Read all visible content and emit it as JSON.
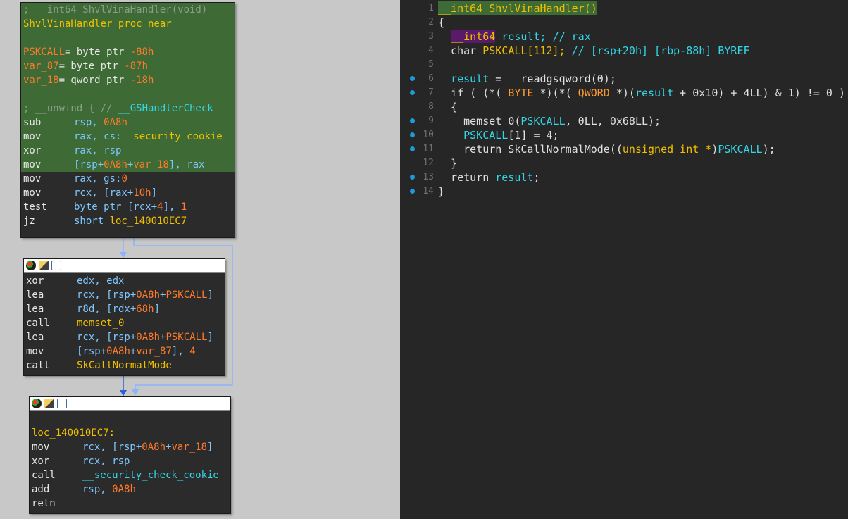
{
  "graph": {
    "block1": {
      "lines": [
        {
          "t": "; __int64 ShvlVinaHandler(void)",
          "c": "comment",
          "hl": true
        },
        {
          "t": "ShvlVinaHandler proc near",
          "c": "yellow",
          "hl": true
        },
        {
          "t": "",
          "c": "white",
          "hl": true
        },
        {
          "parts": [
            [
              "PSKCALL",
              "orange"
            ],
            [
              "= byte ptr ",
              "white"
            ],
            [
              "-88h",
              "num"
            ]
          ],
          "hl": true
        },
        {
          "parts": [
            [
              "var_87",
              "orange"
            ],
            [
              "= byte ptr ",
              "white"
            ],
            [
              "-87h",
              "num"
            ]
          ],
          "hl": true
        },
        {
          "parts": [
            [
              "var_18",
              "orange"
            ],
            [
              "= qword ptr ",
              "white"
            ],
            [
              "-18h",
              "num"
            ]
          ],
          "hl": true
        },
        {
          "t": "",
          "c": "white",
          "hl": true
        },
        {
          "parts": [
            [
              "; __unwind { // ",
              "comment"
            ],
            [
              "__GSHandlerCheck",
              "cyan"
            ]
          ],
          "hl": true
        },
        {
          "mn": "sub",
          "parts": [
            [
              "rsp, ",
              "reg"
            ],
            [
              "0A8h",
              "num"
            ]
          ],
          "hl": true
        },
        {
          "mn": "mov",
          "parts": [
            [
              "rax, cs:",
              "reg"
            ],
            [
              "__security_cookie",
              "yellow"
            ]
          ],
          "hl": true
        },
        {
          "mn": "xor",
          "parts": [
            [
              "rax, rsp",
              "reg"
            ]
          ],
          "hl": true
        },
        {
          "mn": "mov",
          "parts": [
            [
              "[rsp+",
              "reg"
            ],
            [
              "0A8h",
              "num"
            ],
            [
              "+",
              "reg"
            ],
            [
              "var_18",
              "orange"
            ],
            [
              "], rax",
              "reg"
            ]
          ],
          "hl": true
        },
        {
          "mn": "mov",
          "parts": [
            [
              "rax, gs:",
              "reg"
            ],
            [
              "0",
              "num"
            ]
          ],
          "hl": false
        },
        {
          "mn": "mov",
          "parts": [
            [
              "rcx, [rax+",
              "reg"
            ],
            [
              "10h",
              "num"
            ],
            [
              "]",
              "reg"
            ]
          ],
          "hl": false
        },
        {
          "mn": "test",
          "parts": [
            [
              "byte ptr [rcx+",
              "reg"
            ],
            [
              "4",
              "num"
            ],
            [
              "], ",
              "reg"
            ],
            [
              "1",
              "num"
            ]
          ],
          "hl": false
        },
        {
          "mn": "jz",
          "parts": [
            [
              "short ",
              "reg"
            ],
            [
              "loc_140010EC7",
              "yellow"
            ]
          ],
          "hl": false
        }
      ]
    },
    "block2": {
      "lines": [
        {
          "mn": "xor",
          "parts": [
            [
              "edx, edx",
              "reg"
            ]
          ]
        },
        {
          "mn": "lea",
          "parts": [
            [
              "rcx, [rsp+",
              "reg"
            ],
            [
              "0A8h",
              "num"
            ],
            [
              "+",
              "reg"
            ],
            [
              "PSKCALL",
              "orange"
            ],
            [
              "]",
              "reg"
            ]
          ]
        },
        {
          "mn": "lea",
          "parts": [
            [
              "r8d, [rdx+",
              "reg"
            ],
            [
              "68h",
              "num"
            ],
            [
              "]",
              "reg"
            ]
          ]
        },
        {
          "mn": "call",
          "parts": [
            [
              "memset_0",
              "yellow"
            ]
          ]
        },
        {
          "mn": "lea",
          "parts": [
            [
              "rcx, [rsp+",
              "reg"
            ],
            [
              "0A8h",
              "num"
            ],
            [
              "+",
              "reg"
            ],
            [
              "PSKCALL",
              "orange"
            ],
            [
              "]",
              "reg"
            ]
          ]
        },
        {
          "mn": "mov",
          "parts": [
            [
              "[rsp+",
              "reg"
            ],
            [
              "0A8h",
              "num"
            ],
            [
              "+",
              "reg"
            ],
            [
              "var_87",
              "orange"
            ],
            [
              "], ",
              "reg"
            ],
            [
              "4",
              "num"
            ]
          ]
        },
        {
          "mn": "call",
          "parts": [
            [
              "SkCallNormalMode",
              "yellow"
            ]
          ]
        }
      ]
    },
    "block3": {
      "lines": [
        {
          "t": "",
          "c": "white"
        },
        {
          "t": "loc_140010EC7:",
          "c": "yellow"
        },
        {
          "mn": "mov",
          "parts": [
            [
              "rcx, [rsp+",
              "reg"
            ],
            [
              "0A8h",
              "num"
            ],
            [
              "+",
              "reg"
            ],
            [
              "var_18",
              "orange"
            ],
            [
              "]",
              "reg"
            ]
          ]
        },
        {
          "mn": "xor",
          "parts": [
            [
              "rcx, rsp",
              "reg"
            ]
          ]
        },
        {
          "mn": "call",
          "parts": [
            [
              "__security_check_cookie",
              "cyan"
            ]
          ]
        },
        {
          "mn": "add",
          "parts": [
            [
              "rsp, ",
              "reg"
            ],
            [
              "0A8h",
              "num"
            ]
          ]
        },
        {
          "mn": "retn",
          "parts": []
        }
      ]
    },
    "header_icons": [
      "color-palette-icon",
      "edit-name-icon",
      "graph-overview-icon"
    ]
  },
  "pseudocode": {
    "lines": [
      {
        "n": "1",
        "dot": false,
        "hl": true,
        "parts": [
          [
            "__int64 ShvlVinaHandler()",
            "yellow"
          ]
        ]
      },
      {
        "n": "2",
        "dot": false,
        "parts": [
          [
            "{",
            "white"
          ]
        ]
      },
      {
        "n": "3",
        "dot": false,
        "parts": [
          [
            "  ",
            "white"
          ],
          [
            "__int64",
            "purple"
          ],
          [
            " result; ",
            "cyan"
          ],
          [
            "// rax",
            "comment"
          ]
        ]
      },
      {
        "n": "4",
        "dot": false,
        "parts": [
          [
            "  char ",
            "white"
          ],
          [
            "PSKCALL[112]; ",
            "yellow"
          ],
          [
            "// [rsp+20h] [rbp-88h] BYREF",
            "comment"
          ]
        ]
      },
      {
        "n": "5",
        "dot": false,
        "parts": []
      },
      {
        "n": "6",
        "dot": true,
        "parts": [
          [
            "  ",
            "white"
          ],
          [
            "result",
            "cyan"
          ],
          [
            " = __readgsqword(0);",
            "white"
          ]
        ]
      },
      {
        "n": "7",
        "dot": true,
        "parts": [
          [
            "  if ( (*(",
            "white"
          ],
          [
            "_BYTE",
            "orange"
          ],
          [
            " *)(*(",
            "white"
          ],
          [
            "_QWORD",
            "orange"
          ],
          [
            " *)(",
            "white"
          ],
          [
            "result",
            "cyan"
          ],
          [
            " + 0x10) + 4LL) & 1) != 0 )",
            "white"
          ]
        ]
      },
      {
        "n": "8",
        "dot": false,
        "parts": [
          [
            "  {",
            "white"
          ]
        ]
      },
      {
        "n": "9",
        "dot": true,
        "parts": [
          [
            "    memset_0(",
            "white"
          ],
          [
            "PSKCALL",
            "cyan"
          ],
          [
            ", 0LL, 0x68LL);",
            "white"
          ]
        ]
      },
      {
        "n": "10",
        "dot": true,
        "parts": [
          [
            "    ",
            "white"
          ],
          [
            "PSKCALL",
            "cyan"
          ],
          [
            "[1] = 4;",
            "white"
          ]
        ]
      },
      {
        "n": "11",
        "dot": true,
        "parts": [
          [
            "    return SkCallNormalMode((",
            "white"
          ],
          [
            "unsigned int *",
            "yellow"
          ],
          [
            ")",
            "white"
          ],
          [
            "PSKCALL",
            "cyan"
          ],
          [
            ");",
            "white"
          ]
        ]
      },
      {
        "n": "12",
        "dot": false,
        "parts": [
          [
            "  }",
            "white"
          ]
        ]
      },
      {
        "n": "13",
        "dot": true,
        "parts": [
          [
            "  return ",
            "white"
          ],
          [
            "result",
            "cyan"
          ],
          [
            ";",
            "white"
          ]
        ]
      },
      {
        "n": "14",
        "dot": true,
        "parts": [
          [
            "}",
            "white"
          ]
        ]
      }
    ]
  },
  "colors": {
    "graph_bg": "#c8c8c8",
    "block_bg": "#2b2b2b",
    "block_highlight": "#3e6b35",
    "pseudo_bg": "#262626",
    "edge_true": "#2a5fd8",
    "edge_false": "#8ab4ff"
  }
}
